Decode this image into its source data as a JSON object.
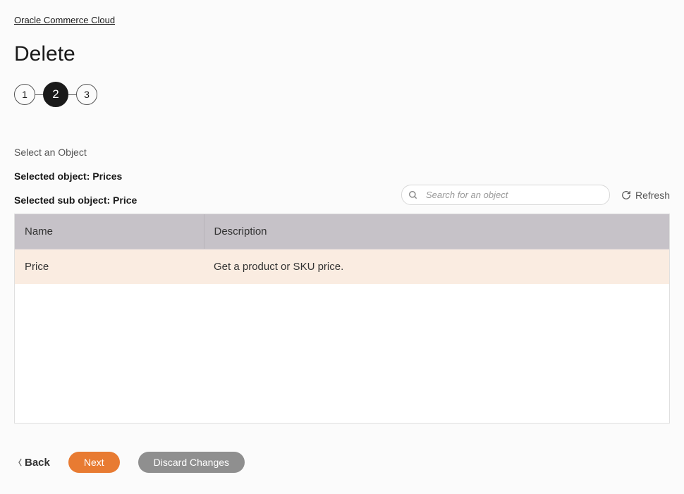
{
  "breadcrumb": {
    "link_label": "Oracle Commerce Cloud"
  },
  "page_title": "Delete",
  "stepper": {
    "steps": [
      "1",
      "2",
      "3"
    ],
    "active_index": 1
  },
  "section": {
    "label": "Select an Object",
    "selected_object_label": "Selected object: Prices",
    "selected_sub_object_label": "Selected sub object: Price"
  },
  "search": {
    "placeholder": "Search for an object"
  },
  "refresh_label": "Refresh",
  "table": {
    "columns": [
      "Name",
      "Description"
    ],
    "rows": [
      {
        "name": "Price",
        "description": "Get a product or SKU price.",
        "selected": true
      }
    ]
  },
  "footer": {
    "back_label": "Back",
    "next_label": "Next",
    "discard_label": "Discard Changes"
  }
}
